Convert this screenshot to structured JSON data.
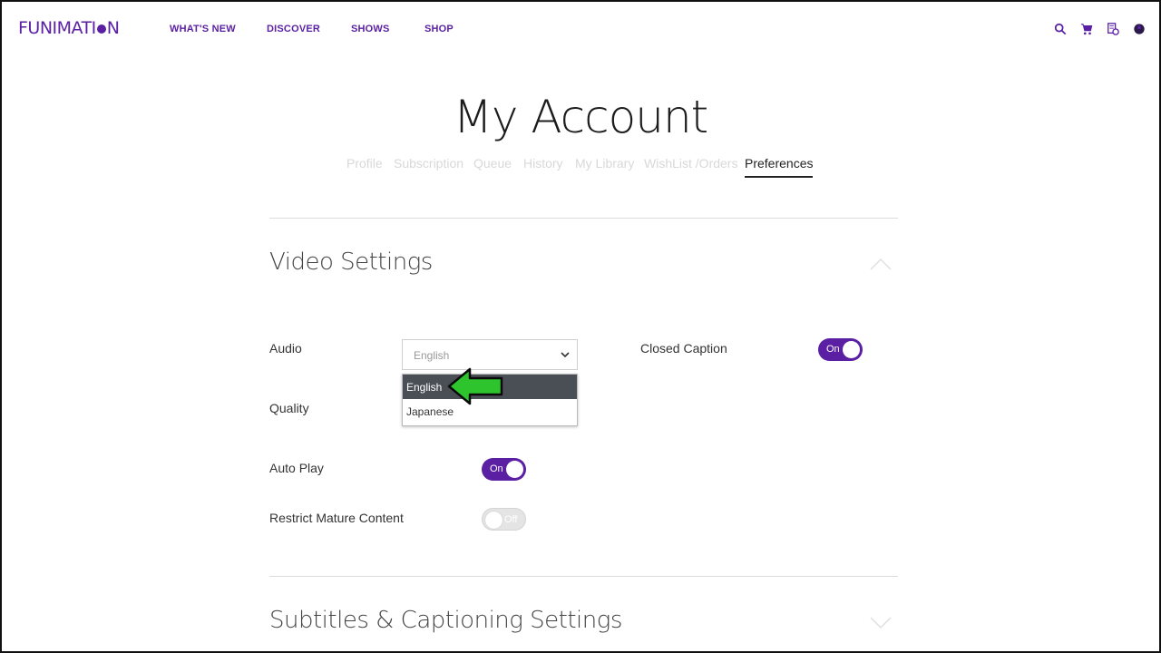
{
  "header": {
    "logo": "FUNIMATION",
    "nav": [
      "WHAT'S NEW",
      "DISCOVER",
      "SHOWS",
      "SHOP"
    ],
    "icons": [
      "search-icon",
      "cart-icon",
      "notifications-icon",
      "user-icon"
    ],
    "brand_color": "#5a1fa3"
  },
  "page": {
    "title": "My Account",
    "tabs": [
      "Profile",
      "Subscription",
      "Queue",
      "History",
      "My Library",
      "WishList /Orders",
      "Preferences"
    ],
    "active_tab": "Preferences"
  },
  "video_settings": {
    "title": "Video Settings",
    "audio": {
      "label": "Audio",
      "selected": "English",
      "options": [
        "English",
        "Japanese"
      ],
      "highlighted": "English"
    },
    "quality": {
      "label": "Quality"
    },
    "closed_caption": {
      "label": "Closed Caption",
      "state": "On"
    },
    "auto_play": {
      "label": "Auto Play",
      "state": "On"
    },
    "restrict_mature": {
      "label": "Restrict Mature Content",
      "state": "Off"
    }
  },
  "subtitles_settings": {
    "title": "Subtitles & Captioning Settings"
  },
  "annotation": {
    "arrow_color": "#2ec42e"
  }
}
